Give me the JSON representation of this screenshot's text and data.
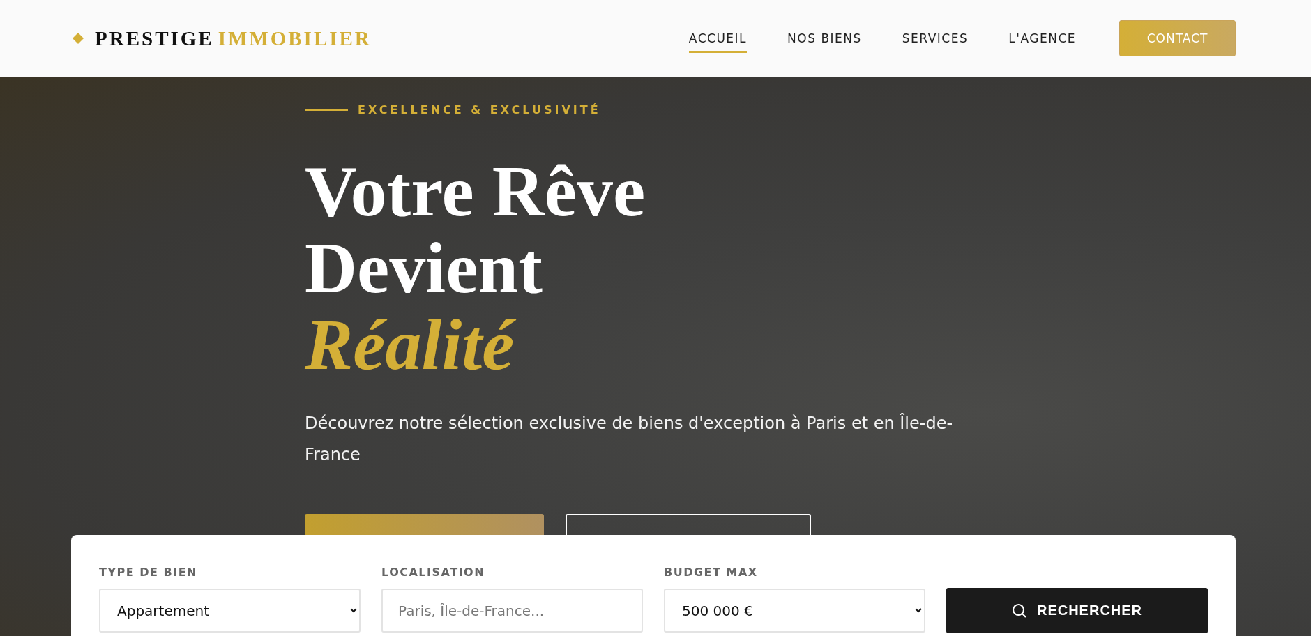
{
  "logo": {
    "word_1": "PRESTIGE",
    "word_2": "IMMOBILIER"
  },
  "nav": [
    {
      "label": "ACCUEIL",
      "selected": true
    },
    {
      "label": "NOS BIENS",
      "selected": false
    },
    {
      "label": "SERVICES",
      "selected": false
    },
    {
      "label": "L'AGENCE",
      "selected": false
    }
  ],
  "contact_button": "CONTACT",
  "hero": {
    "tagline": "EXCELLENCE & EXCLUSIVITÉ",
    "title_lines": [
      "Votre Rêve",
      "Devient"
    ],
    "title_accent": "Réalité",
    "subtitle": "Découvrez notre sélection exclusive de biens d'exception à Paris et en Île-de-France",
    "buttons": [
      {
        "kind": "primary"
      },
      {
        "kind": "outline"
      }
    ]
  },
  "search": {
    "fields": [
      {
        "label": "TYPE DE BIEN",
        "kind": "select",
        "value": "Appartement"
      },
      {
        "label": "LOCALISATION",
        "kind": "input",
        "placeholder": "Paris, Île-de-France..."
      },
      {
        "label": "BUDGET MAX",
        "kind": "select",
        "value": "500 000 €"
      }
    ],
    "button": "RECHERCHER"
  }
}
